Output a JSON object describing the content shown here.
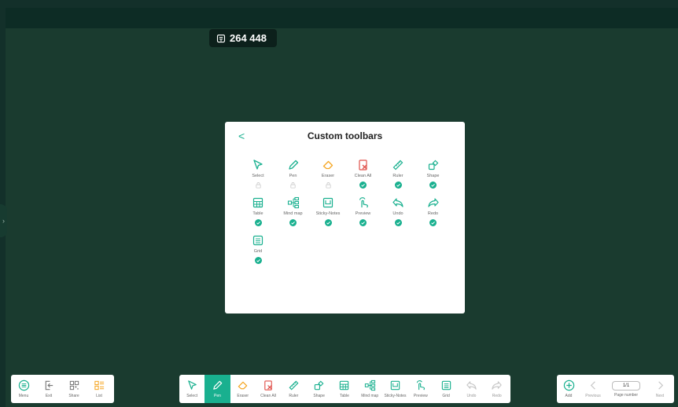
{
  "counter": {
    "value": "264 448",
    "icon": "board-count-icon"
  },
  "panel": {
    "title": "Custom toolbars",
    "back": "<",
    "tools": [
      {
        "label": "Select",
        "icon": "select-icon",
        "status": "locked"
      },
      {
        "label": "Pen",
        "icon": "pen-icon",
        "status": "locked"
      },
      {
        "label": "Eraser",
        "icon": "eraser-icon",
        "status": "locked"
      },
      {
        "label": "Clean All",
        "icon": "clean-all-icon",
        "status": "checked"
      },
      {
        "label": "Ruler",
        "icon": "ruler-icon",
        "status": "checked"
      },
      {
        "label": "Shape",
        "icon": "shape-icon",
        "status": "checked"
      },
      {
        "label": "Table",
        "icon": "table-icon",
        "status": "checked"
      },
      {
        "label": "Mind map",
        "icon": "mind-map-icon",
        "status": "checked"
      },
      {
        "label": "Sticky-Notes",
        "icon": "sticky-notes-icon",
        "status": "checked"
      },
      {
        "label": "Preview",
        "icon": "preview-icon",
        "status": "checked"
      },
      {
        "label": "Undo",
        "icon": "undo-icon",
        "status": "checked"
      },
      {
        "label": "Redo",
        "icon": "redo-icon",
        "status": "checked"
      },
      {
        "label": "Grid",
        "icon": "grid-icon",
        "status": "checked"
      }
    ]
  },
  "left_toolbar": [
    {
      "label": "Menu",
      "icon": "menu-icon"
    },
    {
      "label": "Exit",
      "icon": "exit-icon"
    },
    {
      "label": "Share",
      "icon": "share-icon"
    },
    {
      "label": "List",
      "icon": "list-icon"
    }
  ],
  "center_toolbar": [
    {
      "label": "Select",
      "icon": "select-icon"
    },
    {
      "label": "Pen",
      "icon": "pen-icon",
      "active": true
    },
    {
      "label": "Eraser",
      "icon": "eraser-icon"
    },
    {
      "label": "Clean All",
      "icon": "clean-all-icon"
    },
    {
      "label": "Ruler",
      "icon": "ruler-icon"
    },
    {
      "label": "Shape",
      "icon": "shape-icon"
    },
    {
      "label": "Table",
      "icon": "table-icon"
    },
    {
      "label": "Mind map",
      "icon": "mind-map-icon"
    },
    {
      "label": "Sticky-Notes",
      "icon": "sticky-notes-icon"
    },
    {
      "label": "Preview",
      "icon": "preview-icon"
    },
    {
      "label": "Grid",
      "icon": "grid-icon"
    },
    {
      "label": "Undo",
      "icon": "undo-icon",
      "disabled": true
    },
    {
      "label": "Redo",
      "icon": "redo-icon",
      "disabled": true
    }
  ],
  "right_toolbar": {
    "add": "Add",
    "previous": "Previous",
    "page_value": "1/1",
    "page_label": "Page number",
    "next": "Next"
  },
  "colors": {
    "accent": "#19b08f",
    "background": "#1a3b2f",
    "danger": "#e0504a",
    "orange": "#f5a623",
    "blue": "#3f7fd8"
  }
}
